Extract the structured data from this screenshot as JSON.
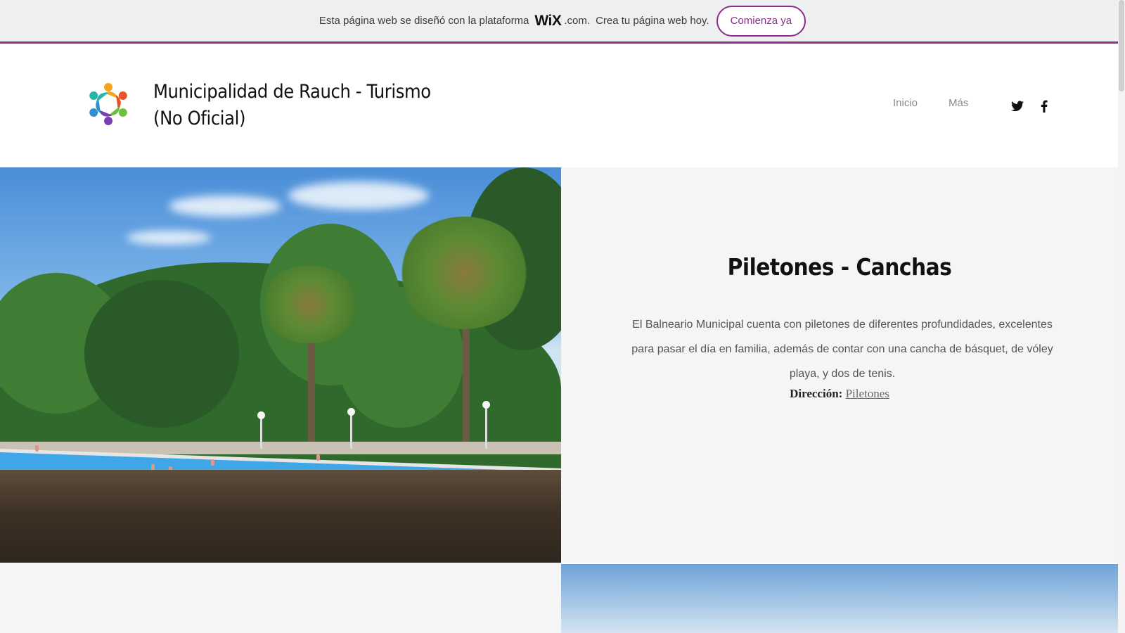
{
  "banner": {
    "text_before": "Esta página web se diseñó con la plataforma",
    "wix_logo": "WiX",
    "wix_domain": ".com.",
    "text_after": "Crea tu página web hoy.",
    "cta_label": "Comienza ya",
    "accent_color": "#8e2c8e"
  },
  "header": {
    "site_title": "Municipalidad de Rauch - Turismo (No Oficial)",
    "logo_icon": "colorful-people-circle-logo",
    "nav": [
      "Inicio",
      "Más"
    ],
    "social_icons": [
      "twitter-icon",
      "facebook-icon"
    ]
  },
  "section": {
    "image_description_icon": "pool-with-palm-trees-photo",
    "title": "Piletones - Canchas",
    "description": "El Balneario Municipal cuenta con piletones de diferentes profundidades, excelentes para pasar el día en familia, además de contar con una cancha de básquet, de vóley playa, y dos de tenis.",
    "address_label": "Dirección:",
    "address_link": "Piletones"
  }
}
